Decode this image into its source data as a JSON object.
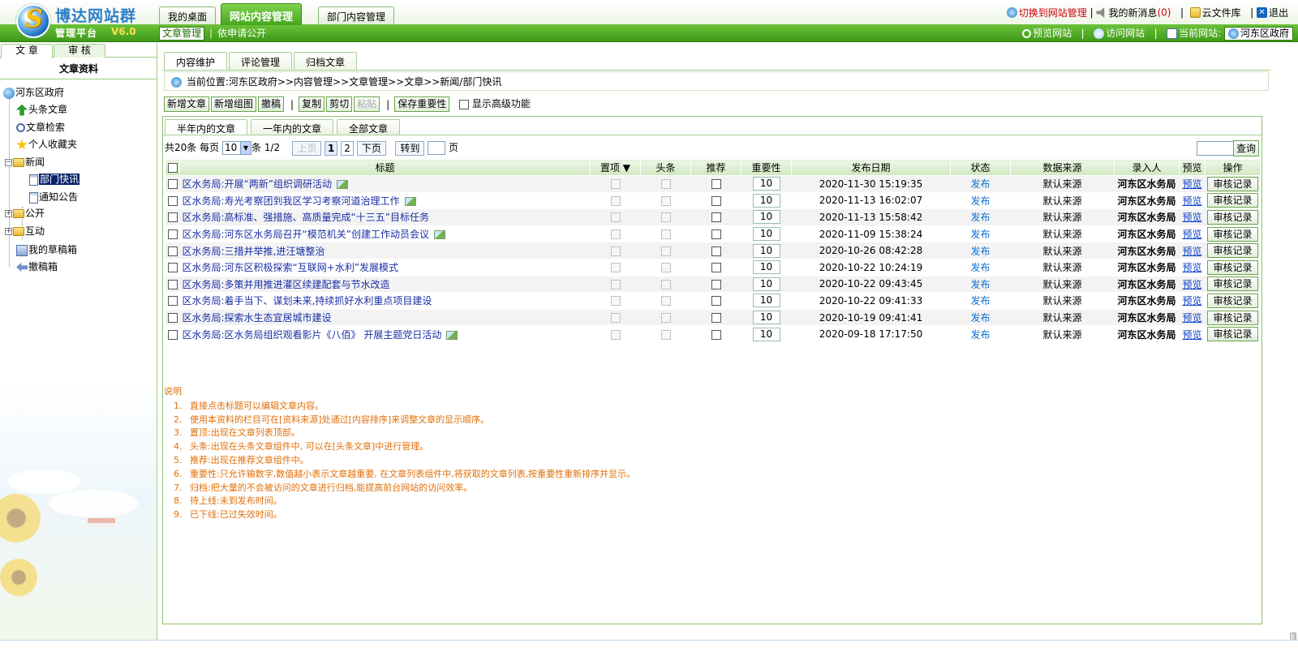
{
  "brand": {
    "title": "博达网站群",
    "subtitle": "管理平台",
    "version": "V6.0"
  },
  "main_tabs": [
    {
      "label": "我的桌面",
      "active": false
    },
    {
      "label": "网站内容管理",
      "active": true
    },
    {
      "label": "部门内容管理",
      "active": false
    }
  ],
  "sub_links": {
    "active": "文章管理",
    "other": "依申请公开"
  },
  "top_right": {
    "switch_admin": "切换到网站管理",
    "messages_label": "我的新消息",
    "messages_count": "(0)",
    "cloud_library": "云文件库",
    "logout": "退出"
  },
  "sub_right": {
    "preview_site": "预览网站",
    "visit_site": "访问网站",
    "current_site_label": "当前网站:",
    "current_site": "河东区政府"
  },
  "left": {
    "tabs": [
      "文 章",
      "审 核"
    ],
    "header": "文章资料",
    "tree": [
      {
        "label": "河东区政府"
      },
      {
        "label": "头条文章"
      },
      {
        "label": "文章检索"
      },
      {
        "label": "个人收藏夹"
      },
      {
        "label": "新闻"
      },
      {
        "label": "部门快讯"
      },
      {
        "label": "通知公告"
      },
      {
        "label": "公开"
      },
      {
        "label": "互动"
      },
      {
        "label": "我的草稿箱"
      },
      {
        "label": "撤稿箱"
      }
    ]
  },
  "content_tabs": [
    "内容维护",
    "评论管理",
    "归档文章"
  ],
  "location": {
    "text": "当前位置:河东区政府>>内容管理>>文章管理>>文章>>新闻/部门快讯"
  },
  "toolbar": {
    "new_article": "新增文章",
    "new_group": "新增组图",
    "withdraw": "撤稿",
    "copy": "复制",
    "cut": "剪切",
    "paste": "粘贴",
    "save_importance": "保存重要性",
    "advanced": "显示高级功能"
  },
  "sub_tabs": [
    "半年内的文章",
    "一年内的文章",
    "全部文章"
  ],
  "pager": {
    "total": "共20条",
    "per_page_label": "每页",
    "per_page_value": "10",
    "unit": "条",
    "page_info": "1/2",
    "prev": "上页",
    "page1": "1",
    "page2": "2",
    "next": "下页",
    "goto": "转到",
    "page_suffix": "页"
  },
  "search_button": "查询",
  "columns": [
    "标题",
    "置项 ▼",
    "头条",
    "推荐",
    "重要性",
    "发布日期",
    "状态",
    "数据来源",
    "录入人",
    "预览",
    "操作"
  ],
  "rows": [
    {
      "title": "区水务局:开展“两新”组织调研活动",
      "has_image": true,
      "importance": "10",
      "date": "2020-11-30 15:19:35",
      "status": "发布",
      "source": "默认来源",
      "author": "河东区水务局",
      "preview": "预览",
      "action": "审核记录"
    },
    {
      "title": "区水务局:寿光考察团到我区学习考察河道治理工作",
      "has_image": true,
      "importance": "10",
      "date": "2020-11-13 16:02:07",
      "status": "发布",
      "source": "默认来源",
      "author": "河东区水务局",
      "preview": "预览",
      "action": "审核记录"
    },
    {
      "title": "区水务局:高标准、强措施、高质量完成“十三五”目标任务",
      "has_image": false,
      "importance": "10",
      "date": "2020-11-13 15:58:42",
      "status": "发布",
      "source": "默认来源",
      "author": "河东区水务局",
      "preview": "预览",
      "action": "审核记录"
    },
    {
      "title": "区水务局:河东区水务局召开“模范机关”创建工作动员会议",
      "has_image": true,
      "importance": "10",
      "date": "2020-11-09 15:38:24",
      "status": "发布",
      "source": "默认来源",
      "author": "河东区水务局",
      "preview": "预览",
      "action": "审核记录"
    },
    {
      "title": "区水务局:三措并举推,进汪塘整治",
      "has_image": false,
      "importance": "10",
      "date": "2020-10-26 08:42:28",
      "status": "发布",
      "source": "默认来源",
      "author": "河东区水务局",
      "preview": "预览",
      "action": "审核记录"
    },
    {
      "title": "区水务局:河东区积极探索“互联网+水利”发展模式",
      "has_image": false,
      "importance": "10",
      "date": "2020-10-22 10:24:19",
      "status": "发布",
      "source": "默认来源",
      "author": "河东区水务局",
      "preview": "预览",
      "action": "审核记录"
    },
    {
      "title": "区水务局:多策并用推进灌区续建配套与节水改造",
      "has_image": false,
      "importance": "10",
      "date": "2020-10-22 09:43:45",
      "status": "发布",
      "source": "默认来源",
      "author": "河东区水务局",
      "preview": "预览",
      "action": "审核记录"
    },
    {
      "title": "区水务局:着手当下、谋划未来,持续抓好水利重点项目建设",
      "has_image": false,
      "importance": "10",
      "date": "2020-10-22 09:41:33",
      "status": "发布",
      "source": "默认来源",
      "author": "河东区水务局",
      "preview": "预览",
      "action": "审核记录"
    },
    {
      "title": "区水务局:探索水生态宜居城市建设",
      "has_image": false,
      "importance": "10",
      "date": "2020-10-19 09:41:41",
      "status": "发布",
      "source": "默认来源",
      "author": "河东区水务局",
      "preview": "预览",
      "action": "审核记录"
    },
    {
      "title": "区水务局:区水务局组织观看影片《八佰》 开展主题党日活动",
      "has_image": true,
      "importance": "10",
      "date": "2020-09-18 17:17:50",
      "status": "发布",
      "source": "默认来源",
      "author": "河东区水务局",
      "preview": "预览",
      "action": "审核记录"
    }
  ],
  "notes": {
    "title": "说明",
    "items": [
      "直接点击标题可以编辑文章内容。",
      "使用本资料的栏目可在[资料来源]处通过[内容排序]来调整文章的显示顺序。",
      "置顶:出现在文章列表顶部。",
      "头条:出现在头条文章组件中, 可以在[头条文章]中进行管理。",
      "推荐:出现在推荐文章组件中。",
      "重要性:只允许输数字,数值越小表示文章越重要, 在文章列表组件中,将获取的文章列表,按重要性重新排序并显示。",
      "归档:把大量的不会被访问的文章进行归档,能提高前台网站的访问效率。",
      "待上线:未到发布时间。",
      "已下线:已过失效时间。"
    ]
  },
  "colors": {
    "accent_green": "#45a61c",
    "link_blue": "#1a2fa5",
    "note_orange": "#e0700a"
  }
}
